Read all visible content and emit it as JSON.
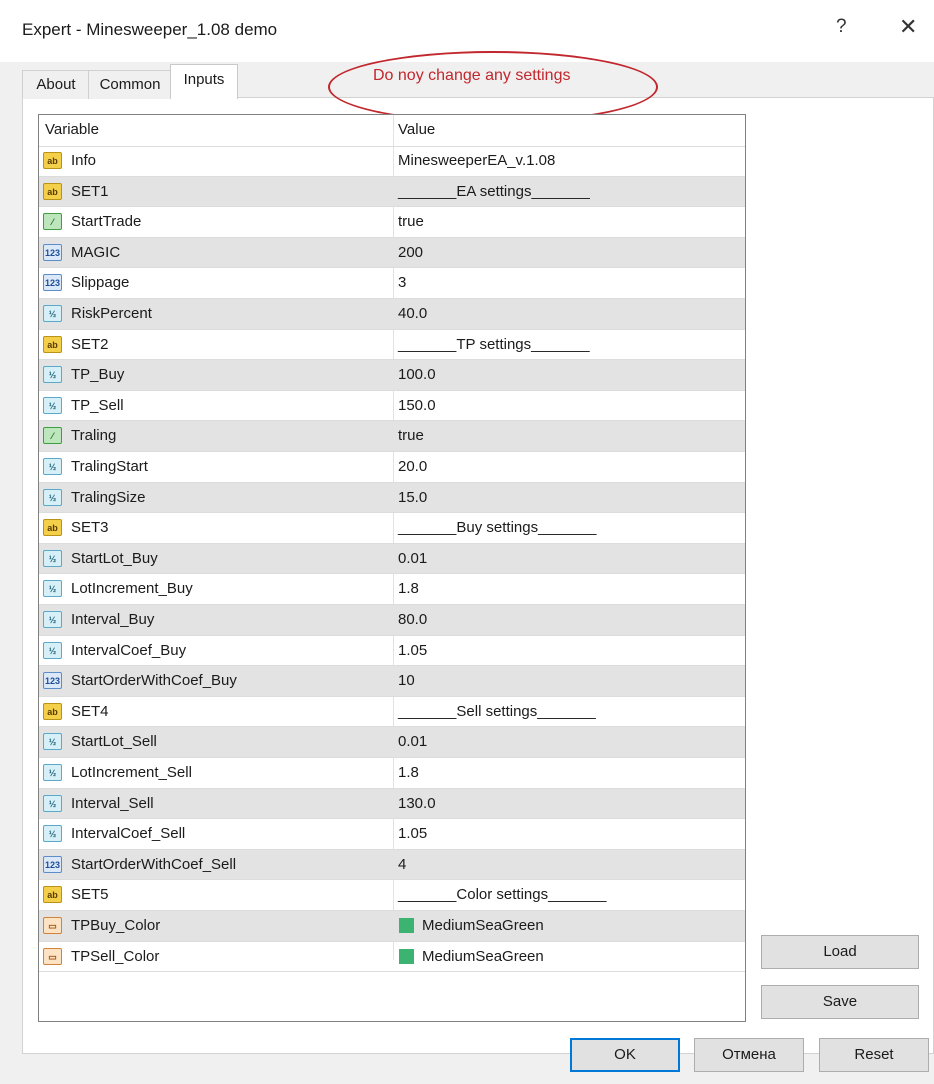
{
  "window": {
    "title": "Expert - Minesweeper_1.08 demo",
    "help": "?",
    "close": "✕"
  },
  "tabs": [
    {
      "label": "About"
    },
    {
      "label": "Common"
    },
    {
      "label": "Inputs",
      "active": true
    }
  ],
  "annotation": {
    "text": "Do noy change any settings",
    "color": "#c1272d"
  },
  "grid": {
    "col_variable": "Variable",
    "col_value": "Value",
    "rows": [
      {
        "type": "ab",
        "name": "Info",
        "value": "MinesweeperEA_v.1.08"
      },
      {
        "type": "ab",
        "name": "SET1",
        "value": "_______EA settings_______"
      },
      {
        "type": "bool",
        "name": "StartTrade",
        "value": "true"
      },
      {
        "type": "int",
        "name": "MAGIC",
        "value": "200"
      },
      {
        "type": "int",
        "name": "Slippage",
        "value": "3"
      },
      {
        "type": "dbl",
        "name": "RiskPercent",
        "value": "40.0"
      },
      {
        "type": "ab",
        "name": "SET2",
        "value": "_______TP settings_______"
      },
      {
        "type": "dbl",
        "name": "TP_Buy",
        "value": "100.0"
      },
      {
        "type": "dbl",
        "name": "TP_Sell",
        "value": "150.0"
      },
      {
        "type": "bool",
        "name": "Traling",
        "value": "true"
      },
      {
        "type": "dbl",
        "name": "TralingStart",
        "value": "20.0"
      },
      {
        "type": "dbl",
        "name": "TralingSize",
        "value": "15.0"
      },
      {
        "type": "ab",
        "name": "SET3",
        "value": "_______Buy settings_______"
      },
      {
        "type": "dbl",
        "name": "StartLot_Buy",
        "value": "0.01"
      },
      {
        "type": "dbl",
        "name": "LotIncrement_Buy",
        "value": "1.8"
      },
      {
        "type": "dbl",
        "name": "Interval_Buy",
        "value": "80.0"
      },
      {
        "type": "dbl",
        "name": "IntervalCoef_Buy",
        "value": "1.05"
      },
      {
        "type": "int",
        "name": "StartOrderWithCoef_Buy",
        "value": "10"
      },
      {
        "type": "ab",
        "name": "SET4",
        "value": "_______Sell settings_______"
      },
      {
        "type": "dbl",
        "name": "StartLot_Sell",
        "value": "0.01"
      },
      {
        "type": "dbl",
        "name": "LotIncrement_Sell",
        "value": "1.8"
      },
      {
        "type": "dbl",
        "name": "Interval_Sell",
        "value": "130.0"
      },
      {
        "type": "dbl",
        "name": "IntervalCoef_Sell",
        "value": "1.05"
      },
      {
        "type": "int",
        "name": "StartOrderWithCoef_Sell",
        "value": "4"
      },
      {
        "type": "ab",
        "name": "SET5",
        "value": "_______Color settings_______"
      },
      {
        "type": "color",
        "name": "TPBuy_Color",
        "value": "MediumSeaGreen",
        "swatch": "#3cb371"
      },
      {
        "type": "color",
        "name": "TPSell_Color",
        "value": "MediumSeaGreen",
        "swatch": "#3cb371"
      }
    ]
  },
  "icons": {
    "ab": {
      "glyph": "ab",
      "name": "string-type-icon"
    },
    "int": {
      "glyph": "123",
      "name": "integer-type-icon"
    },
    "dbl": {
      "glyph": "½",
      "name": "double-type-icon"
    },
    "bool": {
      "glyph": "⁄",
      "name": "boolean-type-icon"
    },
    "color": {
      "glyph": "▭",
      "name": "color-type-icon"
    }
  },
  "buttons": {
    "load": "Load",
    "save": "Save",
    "ok": "OK",
    "cancel": "Отмена",
    "reset": "Reset"
  }
}
